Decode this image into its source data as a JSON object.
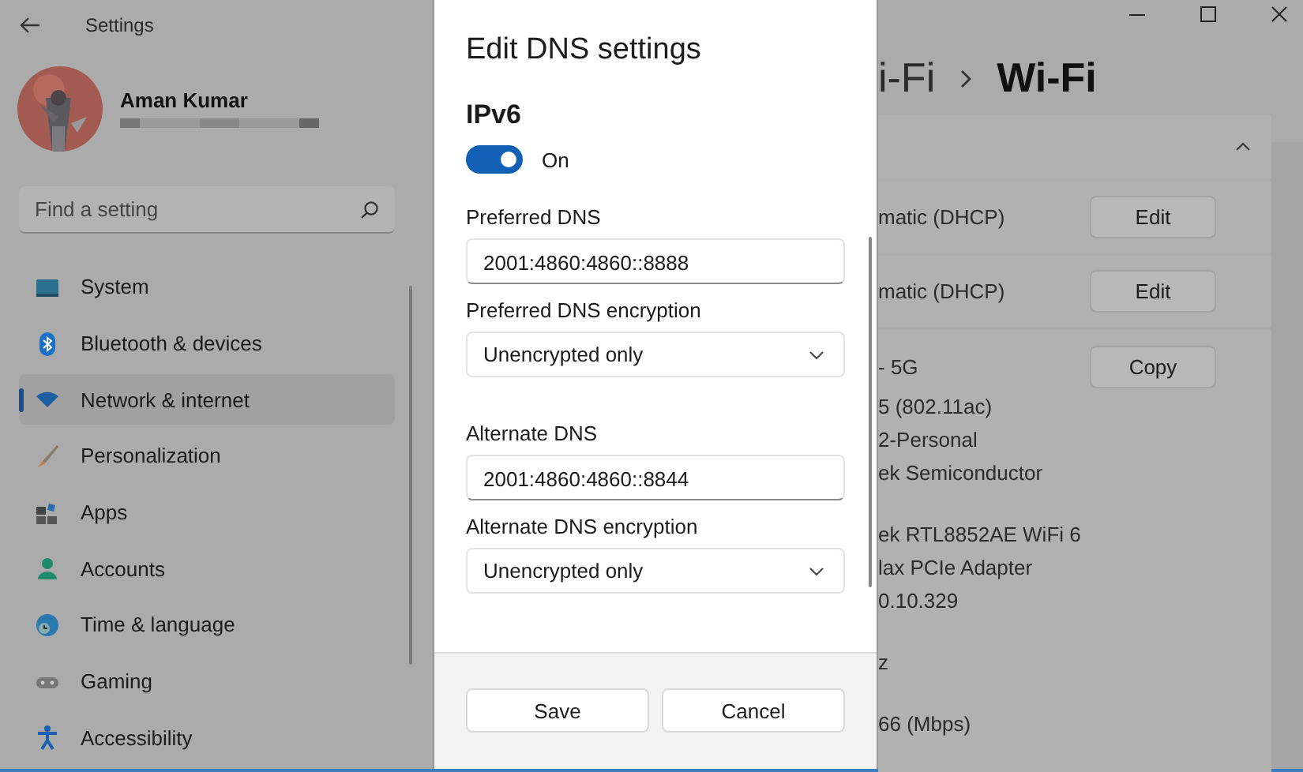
{
  "window": {
    "title": "Settings"
  },
  "account": {
    "name": "Aman Kumar"
  },
  "search": {
    "placeholder": "Find a setting"
  },
  "nav": [
    {
      "label": "System",
      "selected": false
    },
    {
      "label": "Bluetooth & devices",
      "selected": false
    },
    {
      "label": "Network & internet",
      "selected": true
    },
    {
      "label": "Personalization",
      "selected": false
    },
    {
      "label": "Apps",
      "selected": false
    },
    {
      "label": "Accounts",
      "selected": false
    },
    {
      "label": "Time & language",
      "selected": false
    },
    {
      "label": "Gaming",
      "selected": false
    },
    {
      "label": "Accessibility",
      "selected": false
    }
  ],
  "dialog": {
    "title": "Edit DNS settings",
    "section": "IPv6",
    "toggle": {
      "on": true,
      "label": "On"
    },
    "fields": [
      {
        "kind": "text",
        "label": "Preferred DNS",
        "value": "2001:4860:4860::8888"
      },
      {
        "kind": "dropdown",
        "label": "Preferred DNS encryption",
        "value": "Unencrypted only"
      },
      {
        "kind": "text",
        "label": "Alternate DNS",
        "value": "2001:4860:4860::8844"
      },
      {
        "kind": "dropdown",
        "label": "Alternate DNS encryption",
        "value": "Unencrypted only"
      }
    ],
    "buttons": [
      "Save",
      "Cancel"
    ]
  },
  "page": {
    "breadcrumb": [
      "i-Fi",
      "Wi-Fi"
    ],
    "section": {
      "expanded": true,
      "rows": [
        {
          "value": "matic (DHCP)",
          "button": "Edit"
        },
        {
          "value": "matic (DHCP)",
          "button": "Edit"
        }
      ],
      "details": {
        "button": "Copy",
        "groups": [
          [
            "- 5G",
            "5 (802.11ac)",
            "2-Personal",
            "ek Semiconductor"
          ],
          [
            "ek RTL8852AE WiFi 6",
            "lax PCIe Adapter",
            "0.10.329"
          ],
          [
            "z"
          ],
          [
            "66 (Mbps)"
          ]
        ]
      }
    }
  }
}
